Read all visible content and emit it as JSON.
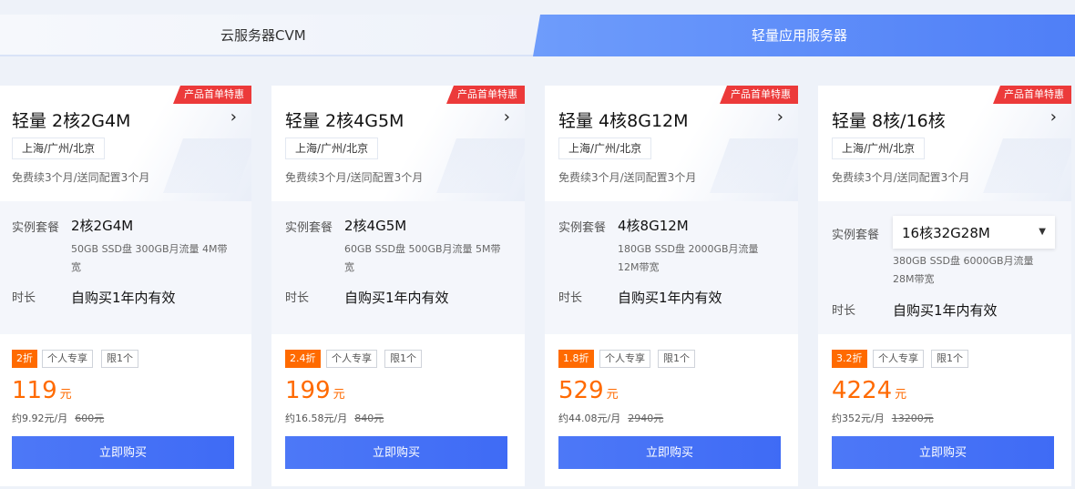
{
  "tabs": {
    "cvm": "云服务器CVM",
    "lighthouse": "轻量应用服务器"
  },
  "common": {
    "badge": "产品首单特惠",
    "region": "上海/广州/北京",
    "promo": "免费续3个月/送同配置3个月",
    "spec_label": "实例套餐",
    "duration_label": "时长",
    "duration_value": "自购买1年内有效",
    "tag_personal": "个人专享",
    "tag_limit": "限1个",
    "price_unit": "元",
    "buy_label": "立即购买",
    "arrow": "›"
  },
  "cards": [
    {
      "title": "轻量 2核2G4M",
      "spec": "2核2G4M",
      "spec_desc": "50GB SSD盘 300GB月流量 4M带宽",
      "discount": "2折",
      "price": "119",
      "per_month": "约9.92元/月",
      "original": "600元"
    },
    {
      "title": "轻量 2核4G5M",
      "spec": "2核4G5M",
      "spec_desc": "60GB SSD盘 500GB月流量 5M带宽",
      "discount": "2.4折",
      "price": "199",
      "per_month": "约16.58元/月",
      "original": "840元"
    },
    {
      "title": "轻量 4核8G12M",
      "spec": "4核8G12M",
      "spec_desc": "180GB SSD盘 2000GB月流量 12M带宽",
      "discount": "1.8折",
      "price": "529",
      "per_month": "约44.08元/月",
      "original": "2940元"
    },
    {
      "title": "轻量 8核/16核",
      "spec": "16核32G28M",
      "spec_desc": "380GB SSD盘 6000GB月流量 28M带宽",
      "discount": "3.2折",
      "price": "4224",
      "per_month": "约352元/月",
      "original": "13200元"
    }
  ],
  "colors": {
    "accent": "#4d78f7",
    "price": "#ff6a00",
    "badge": "#ec3a3a"
  }
}
